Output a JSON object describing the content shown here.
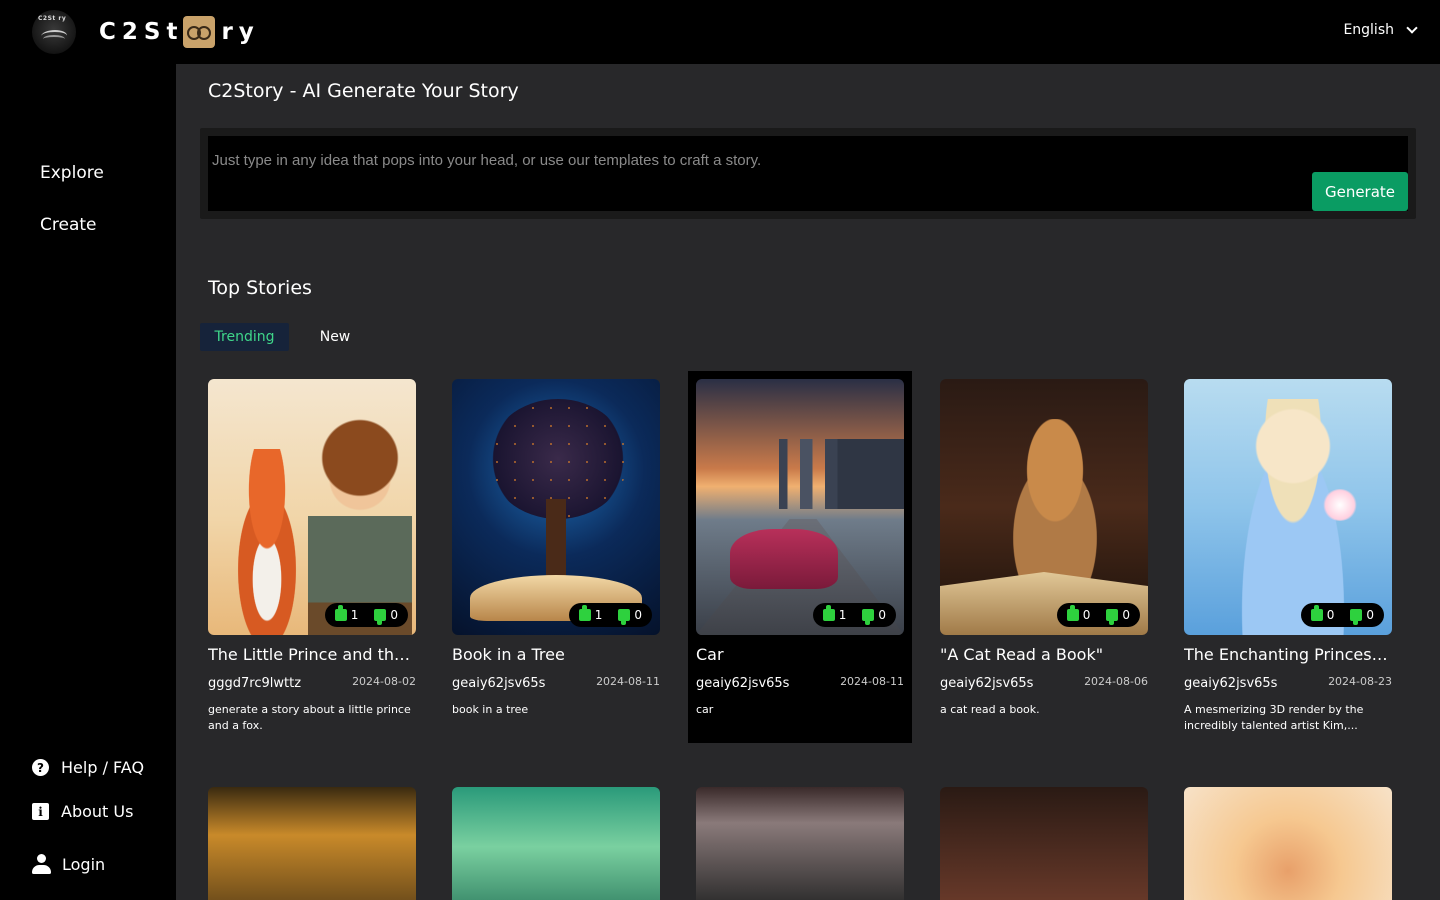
{
  "header": {
    "logo_tiny_text": "C2St  ry",
    "brand_left": "C2St",
    "brand_right": "ry",
    "language": "English"
  },
  "sidebar": {
    "nav": [
      {
        "label": "Explore"
      },
      {
        "label": "Create"
      }
    ],
    "footer": [
      {
        "label": "Help / FAQ",
        "icon": "help-circle-icon",
        "glyph": "?"
      },
      {
        "label": "About Us",
        "icon": "info-icon",
        "glyph": "i"
      },
      {
        "label": "Login",
        "icon": "user-icon"
      }
    ]
  },
  "main": {
    "title": "C2Story - AI Generate Your Story",
    "prompt": {
      "placeholder": "Just type in any idea that pops into your head, or use our templates to craft a story.",
      "value": "",
      "button_label": "Generate"
    },
    "section_title": "Top Stories",
    "tabs": [
      {
        "label": "Trending",
        "active": true
      },
      {
        "label": "New",
        "active": false
      }
    ],
    "stories": [
      {
        "title": "The Little Prince and the Fox",
        "author": "gggd7rc9lwttz",
        "date": "2024-08-02",
        "description": "generate a story about a little prince and a fox.",
        "likes": "1",
        "dislikes": "0"
      },
      {
        "title": "Book in a Tree",
        "author": "geaiy62jsv65s",
        "date": "2024-08-11",
        "description": "book in a tree",
        "likes": "1",
        "dislikes": "0"
      },
      {
        "title": "Car",
        "author": "geaiy62jsv65s",
        "date": "2024-08-11",
        "description": "car",
        "likes": "1",
        "dislikes": "0",
        "selected": true
      },
      {
        "title": "\"A Cat Read a Book\"",
        "author": "geaiy62jsv65s",
        "date": "2024-08-06",
        "description": "a cat read a book.",
        "likes": "0",
        "dislikes": "0"
      },
      {
        "title": "The Enchanting Princess A...",
        "author": "geaiy62jsv65s",
        "date": "2024-08-23",
        "description": "A mesmerizing 3D render by the incredibly talented artist Kim,...",
        "likes": "0",
        "dislikes": "0"
      }
    ]
  },
  "colors": {
    "accent_green": "#0a9c63",
    "tab_active_text": "#3fd68a",
    "vote_green": "#2ed13e"
  }
}
